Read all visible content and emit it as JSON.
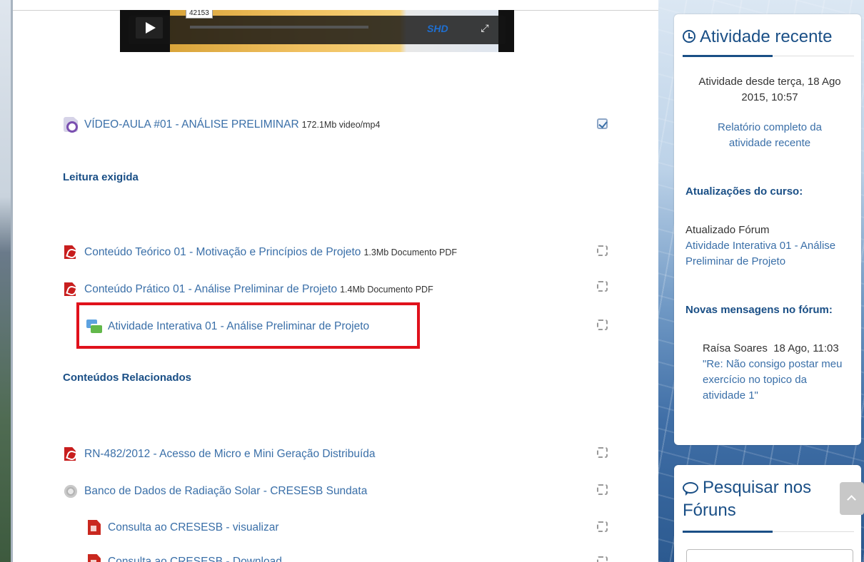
{
  "video": {
    "time_tooltip": "42153",
    "brand_text": "SHD"
  },
  "main": {
    "video_item": {
      "label": "VÍDEO-AULA #01 - ANÁLISE PRELIMINAR",
      "meta": "172.1Mb video/mp4",
      "completed": true
    },
    "section_required": "Leitura exigida",
    "required_items": [
      {
        "label": "Conteúdo Teórico 01 - Motivação e Princípios de Projeto",
        "meta": "1.3Mb Documento PDF"
      },
      {
        "label": "Conteúdo Prático 01 - Análise Preliminar de Projeto",
        "meta": "1.4Mb Documento PDF"
      },
      {
        "label": "Atividade Interativa 01 - Análise Preliminar de Projeto",
        "meta": ""
      }
    ],
    "section_related": "Conteúdos Relacionados",
    "related_items": [
      {
        "label": "RN-482/2012 - Acesso de Micro e Mini Geração Distribuída"
      },
      {
        "label": "Banco de Dados de Radiação Solar - CRESESB Sundata"
      },
      {
        "label": "Consulta ao CRESESB - visualizar"
      },
      {
        "label": "Consulta ao CRESESB - Download"
      }
    ]
  },
  "recent_activity": {
    "title": "Atividade recente",
    "since": "Atividade desde terça, 18 Ago 2015, 10:57",
    "full_report_link": "Relatório completo da atividade recente",
    "course_updates_heading": "Atualizações do curso:",
    "update_text": "Atualizado Fórum",
    "update_link": "Atividade Interativa 01 - Análise Preliminar de Projeto",
    "forum_posts_heading": "Novas mensagens no fórum:",
    "post_author_date": "Raísa Soares  18 Ago, 11:03",
    "post_link": "\"Re: Não consigo postar meu exercício no topico da atividade 1\""
  },
  "search_forums": {
    "title": "Pesquisar nos Fóruns"
  }
}
